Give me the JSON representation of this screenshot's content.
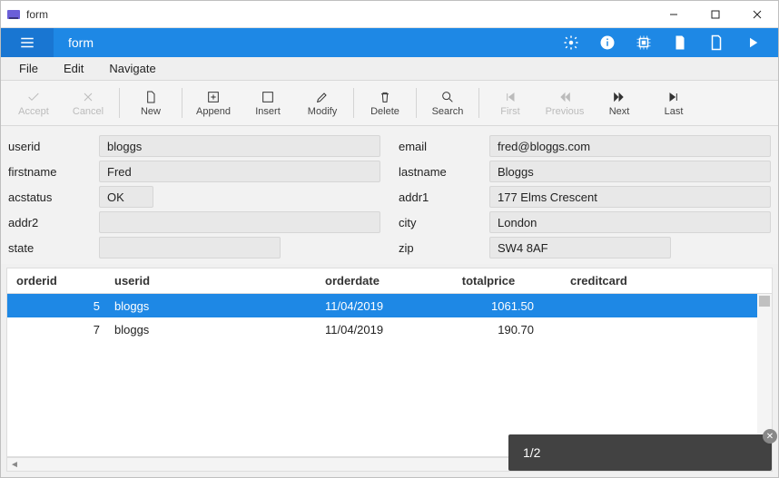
{
  "window": {
    "title": "form"
  },
  "appbar": {
    "title": "form"
  },
  "menubar": {
    "file": "File",
    "edit": "Edit",
    "navigate": "Navigate"
  },
  "toolbar": {
    "accept": "Accept",
    "cancel": "Cancel",
    "new": "New",
    "append": "Append",
    "insert": "Insert",
    "modify": "Modify",
    "delete": "Delete",
    "search": "Search",
    "first": "First",
    "previous": "Previous",
    "next": "Next",
    "last": "Last"
  },
  "form": {
    "labels": {
      "userid": "userid",
      "firstname": "firstname",
      "acstatus": "acstatus",
      "addr2": "addr2",
      "state": "state",
      "email": "email",
      "lastname": "lastname",
      "addr1": "addr1",
      "city": "city",
      "zip": "zip"
    },
    "values": {
      "userid": "bloggs",
      "firstname": "Fred",
      "acstatus": "OK",
      "addr2": "",
      "state": "",
      "email": "fred@bloggs.com",
      "lastname": "Bloggs",
      "addr1": "177 Elms Crescent",
      "city": "London",
      "zip": "SW4 8AF"
    }
  },
  "grid": {
    "headers": {
      "orderid": "orderid",
      "userid": "userid",
      "orderdate": "orderdate",
      "totalprice": "totalprice",
      "creditcard": "creditcard"
    },
    "rows": [
      {
        "orderid": "5",
        "userid": "bloggs",
        "orderdate": "11/04/2019",
        "totalprice": "1061.50",
        "creditcard": ""
      },
      {
        "orderid": "7",
        "userid": "bloggs",
        "orderdate": "11/04/2019",
        "totalprice": "190.70",
        "creditcard": ""
      }
    ]
  },
  "toast": {
    "text": "1/2"
  }
}
